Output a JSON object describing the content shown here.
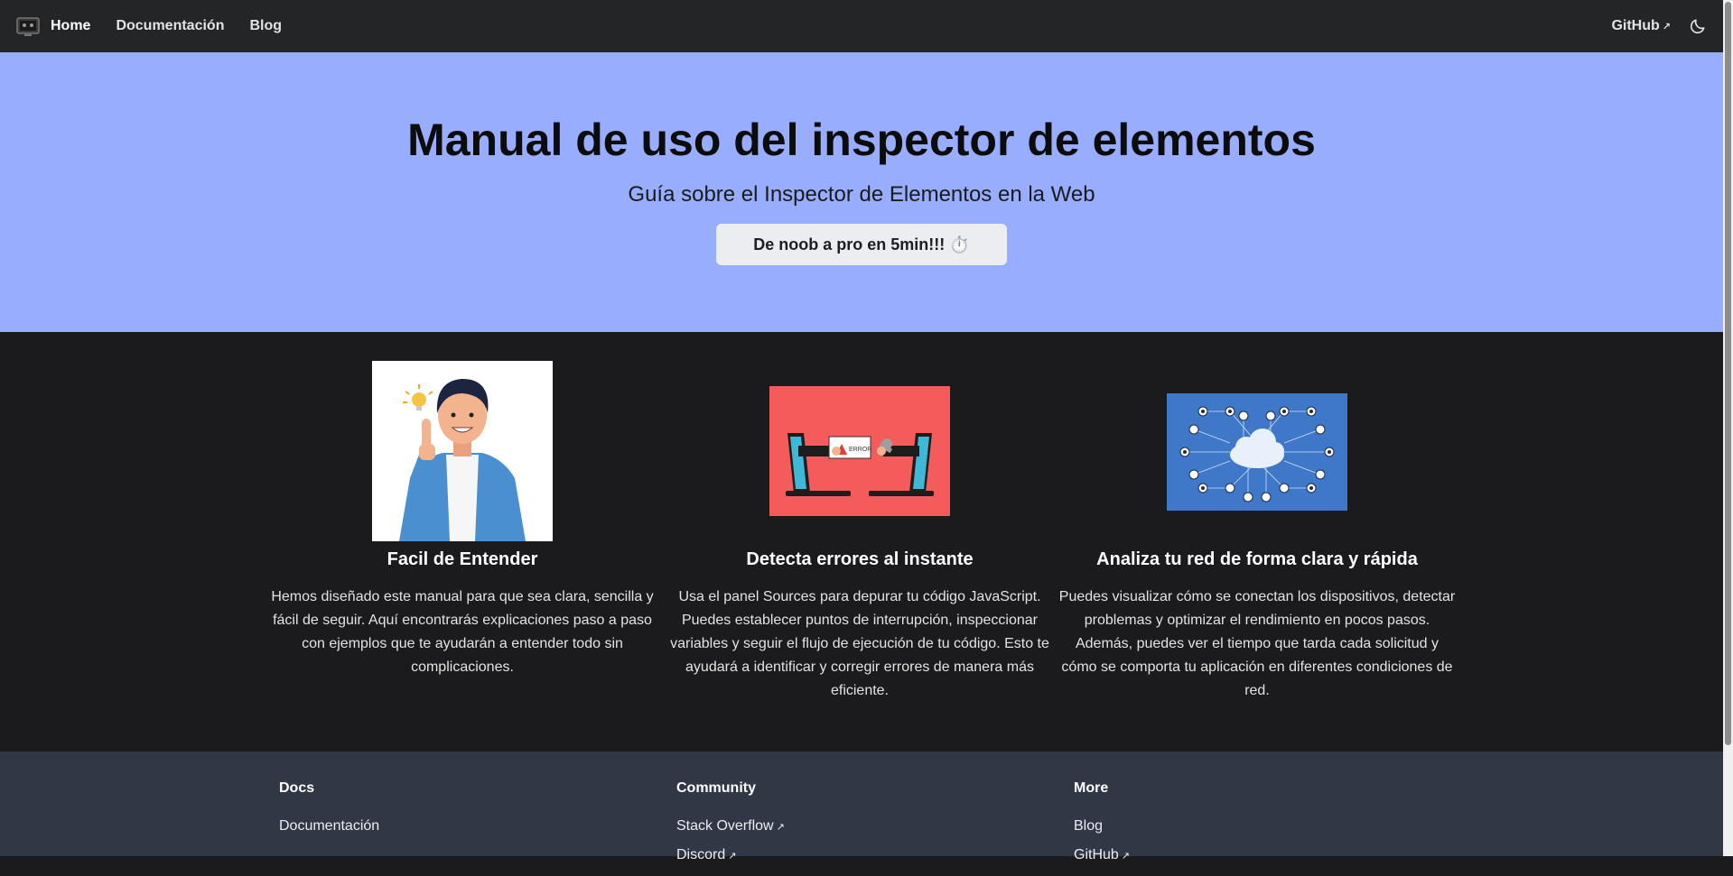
{
  "navbar": {
    "brand": "Home",
    "links": [
      "Documentación",
      "Blog"
    ],
    "github": "GitHub",
    "external_icon": "↗",
    "theme_icon": "moon-icon"
  },
  "hero": {
    "title": "Manual de uso del inspector de elementos",
    "subtitle": "Guía sobre el Inspector de Elementos en la Web",
    "button_label": "De noob a pro en 5min!!! ⏱️"
  },
  "features": [
    {
      "title": "Facil de Entender",
      "text": "Hemos diseñado este manual para que sea clara, sencilla y fácil de seguir. Aquí encontrarás explicaciones paso a paso con ejemplos que te ayudarán a entender todo sin complicaciones."
    },
    {
      "title": "Detecta errores al instante",
      "text": "Usa el panel Sources para depurar tu código JavaScript. Puedes establecer puntos de interrupción, inspeccionar variables y seguir el flujo de ejecución de tu código. Esto te ayudará a identificar y corregir errores de manera más eficiente."
    },
    {
      "title": "Analiza tu red de forma clara y rápida",
      "text": "Puedes visualizar cómo se conectan los dispositivos, detectar problemas y optimizar el rendimiento en pocos pasos. Además, puedes ver el tiempo que tarda cada solicitud y cómo se comporta tu aplicación en diferentes condiciones de red."
    }
  ],
  "footer": {
    "columns": [
      {
        "title": "Docs",
        "links": [
          "Documentación"
        ]
      },
      {
        "title": "Community",
        "links": [
          "Stack Overflow",
          "Discord"
        ]
      },
      {
        "title": "More",
        "links": [
          "Blog",
          "GitHub"
        ]
      }
    ]
  },
  "colors": {
    "hero_bg": "#98adfd",
    "page_bg": "#1b1b1d",
    "navbar_bg": "#242526",
    "footer_bg": "#303846"
  }
}
